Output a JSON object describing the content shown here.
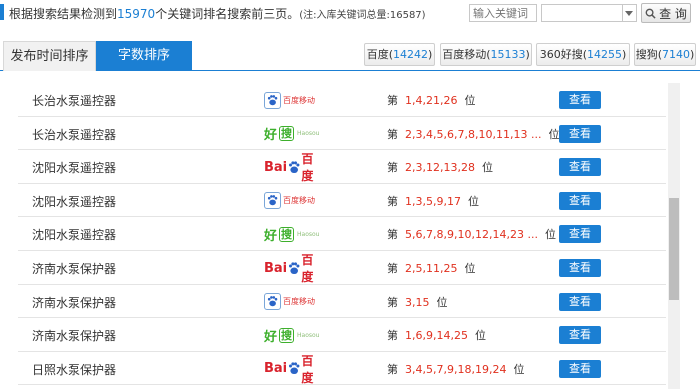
{
  "summary": {
    "prefix": "根据搜索结果检测到",
    "count": "15970",
    "suffix": "个关键词排名搜索前三页。",
    "note": "(注:入库关键词总量:16587)"
  },
  "search": {
    "placeholder": "输入关键词",
    "select_value": "",
    "button_label": "查 询"
  },
  "tabs": [
    {
      "label": "发布时间排序",
      "active": false
    },
    {
      "label": "字数排序",
      "active": true
    }
  ],
  "engines": [
    {
      "name": "百度",
      "count": "14242"
    },
    {
      "name": "百度移动",
      "count": "15133"
    },
    {
      "name": "360好搜",
      "count": "14255"
    },
    {
      "name": "搜狗",
      "count": "7140"
    }
  ],
  "engine_labels": {
    "baidu_mobile_text": "百度移动",
    "haosou_big": "好",
    "haosou_box": "搜",
    "haosou_sub": "Haosou",
    "baidu_en": "Bai",
    "baidu_cn": "百度"
  },
  "rank_prefix": "第",
  "rank_suffix": "位",
  "view_label": "查看",
  "rows": [
    {
      "keyword": "长治水泵遥控器",
      "engine": "baidu-mobile",
      "positions": "1,4,21,26"
    },
    {
      "keyword": "长治水泵遥控器",
      "engine": "haosou",
      "positions": "2,3,4,5,6,7,8,10,11,13 ..."
    },
    {
      "keyword": "沈阳水泵遥控器",
      "engine": "baidu",
      "positions": "2,3,12,13,28"
    },
    {
      "keyword": "沈阳水泵遥控器",
      "engine": "baidu-mobile",
      "positions": "1,3,5,9,17"
    },
    {
      "keyword": "沈阳水泵遥控器",
      "engine": "haosou",
      "positions": "5,6,7,8,9,10,12,14,23 ..."
    },
    {
      "keyword": "济南水泵保护器",
      "engine": "baidu",
      "positions": "2,5,11,25"
    },
    {
      "keyword": "济南水泵保护器",
      "engine": "baidu-mobile",
      "positions": "3,15"
    },
    {
      "keyword": "济南水泵保护器",
      "engine": "haosou",
      "positions": "1,6,9,14,25"
    },
    {
      "keyword": "日照水泵保护器",
      "engine": "baidu",
      "positions": "3,4,5,7,9,18,19,24"
    }
  ],
  "colors": {
    "accent": "#1b7fd3",
    "rank_red": "#e0301e",
    "baidu_red": "#d9232d",
    "haosou_green": "#3daf2c"
  },
  "scrollbar": {
    "position_fraction": 0.38,
    "visible_fraction": 0.33
  }
}
